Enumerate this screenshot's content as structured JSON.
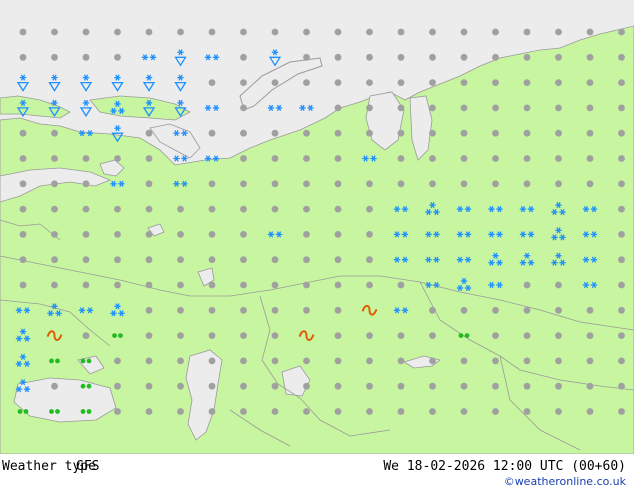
{
  "footer": {
    "title": "Weather type",
    "model": "GFS",
    "datetime": "We 18-02-2026 12:00 UTC (00+60)",
    "credit": "©weatheronline.co.uk"
  },
  "colors": {
    "land": "#c8f5a0",
    "sea": "#ececec",
    "dry_dot": "#a0a0a0",
    "snow": "#1e90ff",
    "rain": "#22bb22",
    "freezing": "#e05a00"
  },
  "icon_legend": {
    "dot": "no-precipitation-dot",
    "snow": "snow-symbol",
    "snow_heavy": "snow-shower-symbol",
    "snow_shower": "snow-shower-triangle-symbol",
    "rain": "rain-drizzle-symbol",
    "freezing": "freezing-rain-symbol"
  },
  "weather_grid": {
    "columns": 20,
    "rows": 16,
    "cells": [
      [
        "dot",
        "dot",
        "dot",
        "dot",
        "dot",
        "dot",
        "dot",
        "dot",
        "dot",
        "dot",
        "dot",
        "dot",
        "dot",
        "dot",
        "dot",
        "dot",
        "dot",
        "dot",
        "dot",
        "dot"
      ],
      [
        "dot",
        "dot",
        "dot",
        "dot",
        "snow",
        "snow_shower",
        "snow",
        "dot",
        "snow_shower",
        "dot",
        "dot",
        "dot",
        "dot",
        "dot",
        "dot",
        "dot",
        "dot",
        "dot",
        "dot",
        "dot"
      ],
      [
        "snow_shower",
        "snow_shower",
        "snow_shower",
        "snow_shower",
        "snow_shower",
        "snow_shower",
        "dot",
        "dot",
        "dot",
        "dot",
        "dot",
        "dot",
        "dot",
        "dot",
        "dot",
        "dot",
        "dot",
        "dot",
        "dot",
        "dot"
      ],
      [
        "snow_shower",
        "snow_shower",
        "snow_shower",
        "snow_heavy",
        "snow_shower",
        "snow_shower",
        "snow",
        "dot",
        "snow",
        "snow",
        "dot",
        "dot",
        "dot",
        "dot",
        "dot",
        "dot",
        "dot",
        "dot",
        "dot",
        "dot"
      ],
      [
        "dot",
        "dot",
        "snow",
        "snow_shower",
        "dot",
        "snow",
        "dot",
        "dot",
        "dot",
        "dot",
        "dot",
        "dot",
        "dot",
        "dot",
        "dot",
        "dot",
        "dot",
        "dot",
        "dot",
        "dot"
      ],
      [
        "dot",
        "dot",
        "dot",
        "dot",
        "dot",
        "snow",
        "snow",
        "dot",
        "dot",
        "dot",
        "dot",
        "snow",
        "dot",
        "dot",
        "dot",
        "dot",
        "dot",
        "dot",
        "dot",
        "dot"
      ],
      [
        "dot",
        "dot",
        "dot",
        "snow",
        "dot",
        "snow",
        "dot",
        "dot",
        "dot",
        "dot",
        "dot",
        "dot",
        "dot",
        "dot",
        "dot",
        "dot",
        "dot",
        "dot",
        "dot",
        "dot"
      ],
      [
        "dot",
        "dot",
        "dot",
        "dot",
        "dot",
        "dot",
        "dot",
        "dot",
        "dot",
        "dot",
        "dot",
        "dot",
        "snow",
        "snow_heavy",
        "snow",
        "snow",
        "snow",
        "snow_heavy",
        "snow",
        "dot"
      ],
      [
        "dot",
        "dot",
        "dot",
        "dot",
        "dot",
        "dot",
        "dot",
        "dot",
        "snow",
        "dot",
        "dot",
        "dot",
        "snow",
        "snow",
        "snow",
        "snow",
        "snow",
        "snow_heavy",
        "snow",
        "dot"
      ],
      [
        "dot",
        "dot",
        "dot",
        "dot",
        "dot",
        "dot",
        "dot",
        "dot",
        "dot",
        "dot",
        "dot",
        "dot",
        "snow",
        "snow",
        "snow",
        "snow_heavy",
        "snow_heavy",
        "snow_heavy",
        "snow",
        "dot"
      ],
      [
        "dot",
        "dot",
        "dot",
        "dot",
        "dot",
        "dot",
        "dot",
        "dot",
        "dot",
        "dot",
        "dot",
        "dot",
        "dot",
        "snow",
        "snow_heavy",
        "snow",
        "dot",
        "dot",
        "snow",
        "dot"
      ],
      [
        "snow",
        "snow_heavy",
        "snow",
        "snow_heavy",
        "dot",
        "dot",
        "dot",
        "dot",
        "dot",
        "dot",
        "dot",
        "freezing",
        "snow",
        "dot",
        "dot",
        "dot",
        "dot",
        "dot",
        "dot",
        "dot"
      ],
      [
        "snow_heavy",
        "freezing",
        "dot",
        "rain",
        "dot",
        "dot",
        "dot",
        "dot",
        "dot",
        "freezing",
        "dot",
        "dot",
        "dot",
        "dot",
        "rain",
        "dot",
        "dot",
        "dot",
        "dot",
        "dot"
      ],
      [
        "snow_heavy",
        "rain",
        "rain",
        "dot",
        "dot",
        "dot",
        "dot",
        "dot",
        "dot",
        "dot",
        "dot",
        "dot",
        "dot",
        "dot",
        "dot",
        "dot",
        "dot",
        "dot",
        "dot",
        "dot"
      ],
      [
        "snow_heavy",
        "dot",
        "rain",
        "dot",
        "dot",
        "dot",
        "dot",
        "dot",
        "dot",
        "dot",
        "dot",
        "dot",
        "dot",
        "dot",
        "dot",
        "dot",
        "dot",
        "dot",
        "dot",
        "dot"
      ],
      [
        "rain",
        "rain",
        "rain",
        "dot",
        "dot",
        "dot",
        "dot",
        "dot",
        "dot",
        "dot",
        "dot",
        "dot",
        "dot",
        "dot",
        "dot",
        "dot",
        "dot",
        "dot",
        "dot",
        "dot"
      ]
    ]
  }
}
